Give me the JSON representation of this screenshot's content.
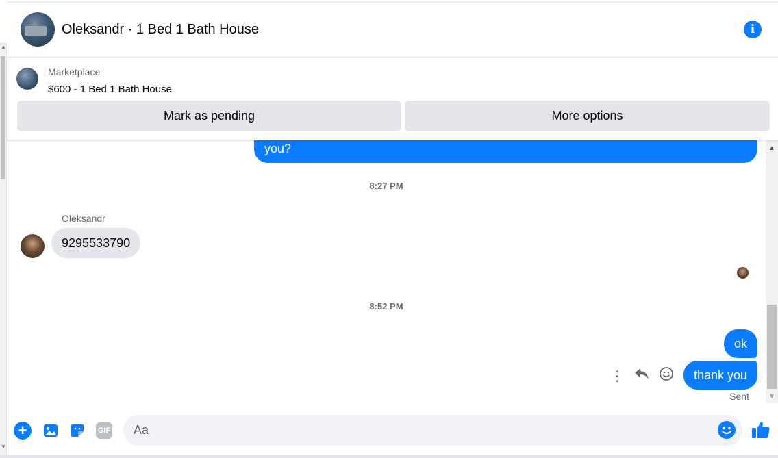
{
  "header": {
    "title": "Oleksandr · 1 Bed 1 Bath House",
    "info_icon": "info-icon"
  },
  "marketplace": {
    "label": "Marketplace",
    "listing": "$600 - 1 Bed 1 Bath House",
    "buttons": {
      "pending": "Mark as pending",
      "more": "More options"
    }
  },
  "messages": {
    "partial_outgoing": "you?",
    "time1": "8:27 PM",
    "sender_name": "Oleksandr",
    "incoming_text": "9295533790",
    "time2": "8:52 PM",
    "outgoing": [
      "ok",
      "thank you"
    ],
    "status": "Sent"
  },
  "composer": {
    "placeholder": "Aa",
    "gif_label": "GIF"
  },
  "colors": {
    "accent": "#0a7cff",
    "bubble_incoming": "#e4e6eb",
    "button_bg": "#e4e6eb",
    "muted_text": "#65676b"
  }
}
